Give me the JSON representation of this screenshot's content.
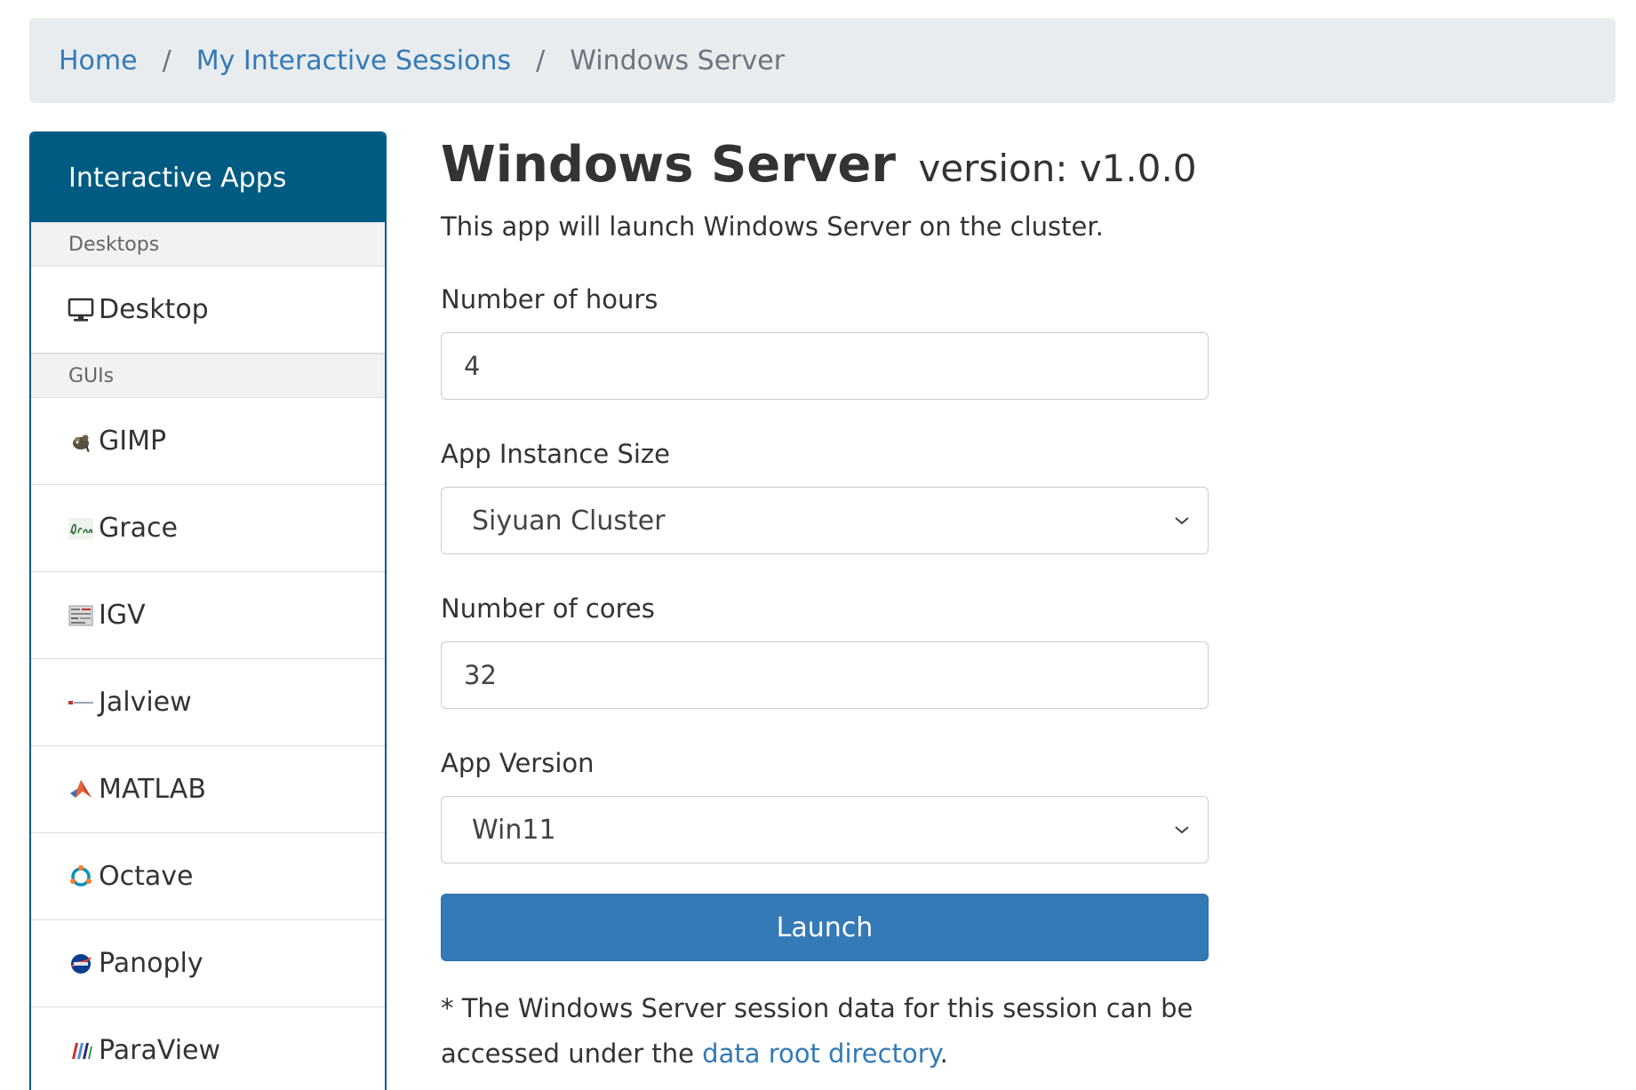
{
  "breadcrumb": {
    "home": "Home",
    "sessions": "My Interactive Sessions",
    "current": "Windows Server",
    "separator": "/"
  },
  "sidebar": {
    "title": "Interactive Apps",
    "groups": [
      {
        "label": "Desktops",
        "items": [
          {
            "label": "Desktop",
            "icon": "monitor-icon"
          }
        ]
      },
      {
        "label": "GUIs",
        "items": [
          {
            "label": "GIMP",
            "icon": "gimp-icon"
          },
          {
            "label": "Grace",
            "icon": "grace-icon"
          },
          {
            "label": "IGV",
            "icon": "igv-icon"
          },
          {
            "label": "Jalview",
            "icon": "jalview-icon"
          },
          {
            "label": "MATLAB",
            "icon": "matlab-icon"
          },
          {
            "label": "Octave",
            "icon": "octave-icon"
          },
          {
            "label": "Panoply",
            "icon": "nasa-icon"
          },
          {
            "label": "ParaView",
            "icon": "paraview-icon"
          }
        ]
      }
    ]
  },
  "main": {
    "title": "Windows Server",
    "version": "version: v1.0.0",
    "description": "This app will launch Windows Server on the cluster.",
    "fields": {
      "hours": {
        "label": "Number of hours",
        "value": "4"
      },
      "instance_size": {
        "label": "App Instance Size",
        "value": "Siyuan Cluster"
      },
      "cores": {
        "label": "Number of cores",
        "value": "32"
      },
      "app_version": {
        "label": "App Version",
        "value": "Win11"
      }
    },
    "launch_label": "Launch",
    "note_prefix": "* The Windows Server session data for this session can be accessed under the ",
    "note_link": "data root directory",
    "note_suffix": "."
  },
  "colors": {
    "sidebar_header": "#005b83",
    "primary": "#337ab7",
    "breadcrumb_bg": "#e9ecef"
  }
}
